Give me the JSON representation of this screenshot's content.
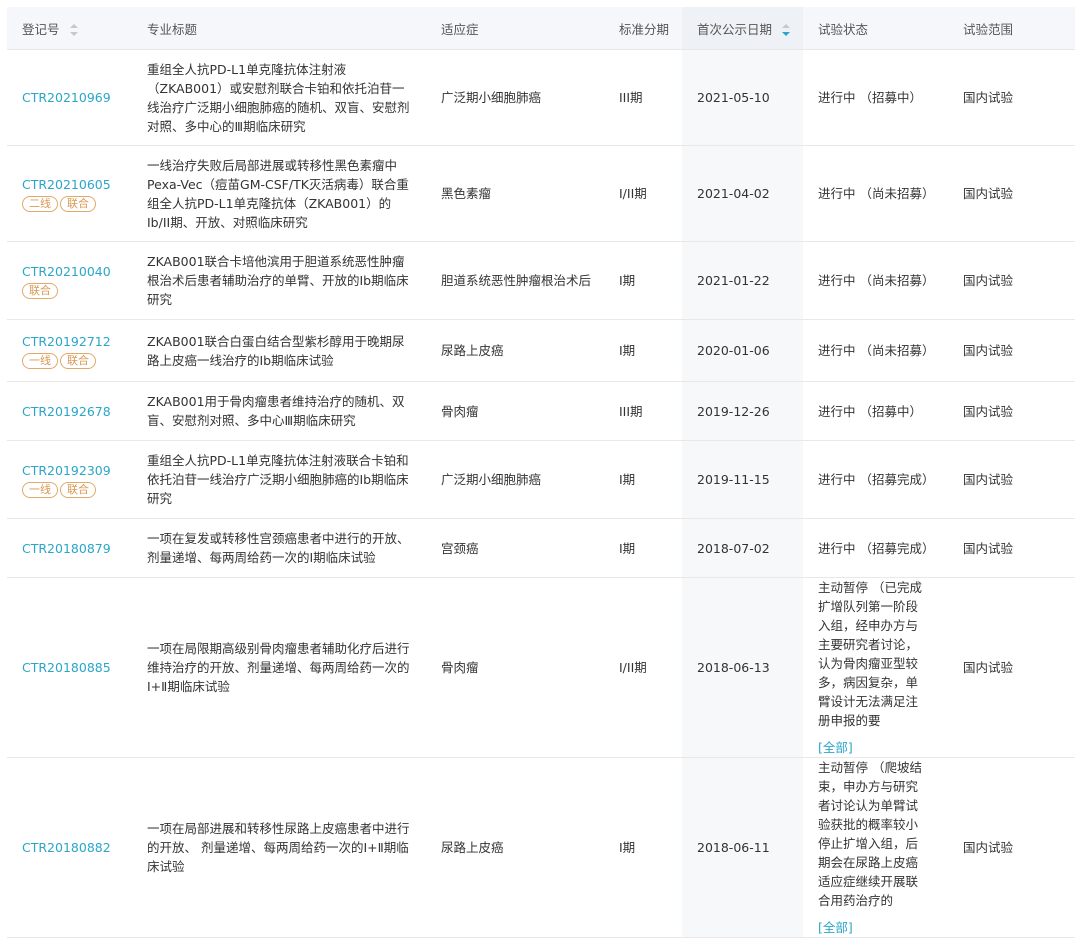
{
  "headers": {
    "reg": "登记号",
    "title": "专业标题",
    "indication": "适应症",
    "phase": "标准分期",
    "date": "首次公示日期",
    "status": "试验状态",
    "scope": "试验范围"
  },
  "more_label": "[全部]",
  "colors": {
    "link": "#2aa6c8",
    "tag": "#d89a55",
    "header_bg": "#f5f7fa"
  },
  "rows": [
    {
      "reg": "CTR20210969",
      "tags": [],
      "title": "重组全人抗PD-L1单克隆抗体注射液（ZKAB001）或安慰剂联合卡铂和依托泊苷一线治疗广泛期小细胞肺癌的随机、双盲、安慰剂对照、多中心的Ⅲ期临床研究",
      "indication": "广泛期小细胞肺癌",
      "phase": "III期",
      "date": "2021-05-10",
      "status": "进行中 （招募中）",
      "scope": "国内试验"
    },
    {
      "reg": "CTR20210605",
      "tags": [
        "二线",
        "联合"
      ],
      "title": "一线治疗失败后局部进展或转移性黑色素瘤中Pexa-Vec（痘苗GM-CSF/TK灭活病毒）联合重组全人抗PD-L1单克隆抗体（ZKAB001）的Ib/II期、开放、对照临床研究",
      "indication": "黑色素瘤",
      "phase": "I/II期",
      "date": "2021-04-02",
      "status": "进行中 （尚未招募）",
      "scope": "国内试验"
    },
    {
      "reg": "CTR20210040",
      "tags": [
        "联合"
      ],
      "title": "ZKAB001联合卡培他滨用于胆道系统恶性肿瘤根治术后患者辅助治疗的单臂、开放的Ib期临床研究",
      "indication": "胆道系统恶性肿瘤根治术后",
      "phase": "I期",
      "date": "2021-01-22",
      "status": "进行中 （尚未招募）",
      "scope": "国内试验"
    },
    {
      "reg": "CTR20192712",
      "tags": [
        "一线",
        "联合"
      ],
      "title": "ZKAB001联合白蛋白结合型紫杉醇用于晚期尿路上皮癌一线治疗的Ib期临床试验",
      "indication": "尿路上皮癌",
      "phase": "I期",
      "date": "2020-01-06",
      "status": "进行中 （尚未招募）",
      "scope": "国内试验"
    },
    {
      "reg": "CTR20192678",
      "tags": [],
      "title": "ZKAB001用于骨肉瘤患者维持治疗的随机、双盲、安慰剂对照、多中心Ⅲ期临床研究",
      "indication": "骨肉瘤",
      "phase": "III期",
      "date": "2019-12-26",
      "status": "进行中 （招募中）",
      "scope": "国内试验"
    },
    {
      "reg": "CTR20192309",
      "tags": [
        "一线",
        "联合"
      ],
      "title": "重组全人抗PD-L1单克隆抗体注射液联合卡铂和依托泊苷一线治疗广泛期小细胞肺癌的Ib期临床研究",
      "indication": "广泛期小细胞肺癌",
      "phase": "I期",
      "date": "2019-11-15",
      "status": "进行中 （招募完成）",
      "scope": "国内试验"
    },
    {
      "reg": "CTR20180879",
      "tags": [],
      "title": "一项在复发或转移性宫颈癌患者中进行的开放、剂量递增、每两周给药一次的Ⅰ期临床试验",
      "indication": "宫颈癌",
      "phase": "I期",
      "date": "2018-07-02",
      "status": "进行中 （招募完成）",
      "scope": "国内试验"
    },
    {
      "reg": "CTR20180885",
      "tags": [],
      "title": "一项在局限期高级别骨肉瘤患者辅助化疗后进行维持治疗的开放、剂量递增、每两周给药一次的Ⅰ+Ⅱ期临床试验",
      "indication": "骨肉瘤",
      "phase": "I/II期",
      "date": "2018-06-13",
      "status": "主动暂停 （已完成扩增队列第一阶段入组，经申办方与主要研究者讨论，认为骨肉瘤亚型较多，病因复杂，单臂设计无法满足注册申报的要",
      "more": true,
      "scope": "国内试验"
    },
    {
      "reg": "CTR20180882",
      "tags": [],
      "title": "一项在局部进展和转移性尿路上皮癌患者中进行的开放、 剂量递增、每两周给药一次的Ⅰ+Ⅱ期临床试验",
      "indication": "尿路上皮癌",
      "phase": "I期",
      "date": "2018-06-11",
      "status": "主动暂停 （爬坡结束，申办方与研究者讨论认为单臂试验获批的概率较小停止扩增入组，后期会在尿路上皮癌适应症继续开展联合用药治疗的",
      "more": true,
      "scope": "国内试验"
    }
  ]
}
